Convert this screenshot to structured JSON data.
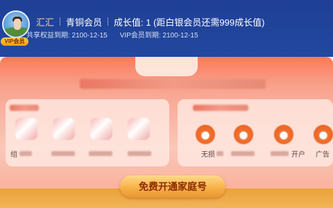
{
  "header": {
    "username": "汇汇",
    "level": "青铜会员",
    "growth_value": "成长值: 1 (距白银会员还需999成长值)",
    "vip_badge": "VIP会员",
    "shared_expiry": "共享权益到期: 2100-12-15",
    "vip_expiry": "VIP会员到期: 2100-12-15"
  },
  "benefits_left": {
    "visible_labels": [
      "组"
    ]
  },
  "benefits_right": {
    "visible_labels": [
      "无损",
      "开户",
      "广告"
    ]
  },
  "cta": {
    "label": "免费开通家庭号"
  },
  "colors": {
    "header_bg": "#1f3f96",
    "card_bg": "#fb7a5b",
    "cta_bg": "#f7b24a",
    "cta_text": "#8a2a00",
    "username": "#f5d7a3"
  }
}
